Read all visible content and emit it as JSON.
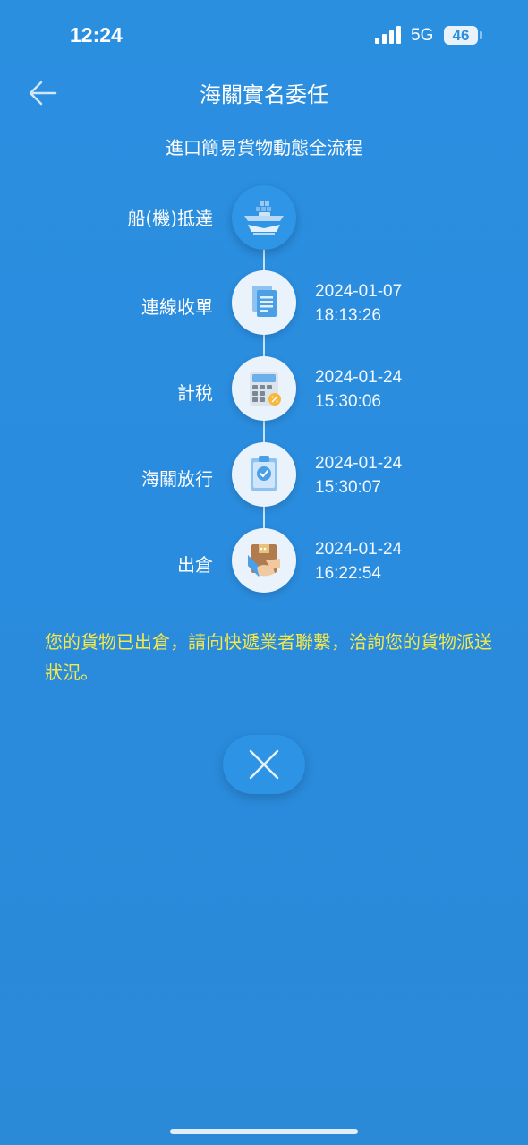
{
  "status_bar": {
    "time": "12:24",
    "network": "5G",
    "battery": "46",
    "signal_icon": "cellular-signal-icon"
  },
  "header": {
    "back_icon": "arrow-left-icon",
    "title": "海關實名委任"
  },
  "subtitle": "進口簡易貨物動態全流程",
  "timeline": [
    {
      "label": "船(機)抵達",
      "icon": "ship-plane-icon",
      "date": "",
      "time": ""
    },
    {
      "label": "連線收單",
      "icon": "document-icon",
      "date": "2024-01-07",
      "time": "18:13:26"
    },
    {
      "label": "計稅",
      "icon": "calculator-icon",
      "date": "2024-01-24",
      "time": "15:30:06"
    },
    {
      "label": "海關放行",
      "icon": "clipboard-check-icon",
      "date": "2024-01-24",
      "time": "15:30:07"
    },
    {
      "label": "出倉",
      "icon": "package-handover-icon",
      "date": "2024-01-24",
      "time": "16:22:54"
    }
  ],
  "notice": "您的貨物已出倉，請向快遞業者聯繫，洽詢您的貨物派送狀況。",
  "close_icon": "close-icon",
  "colors": {
    "background": "#2b8fe0",
    "notice_text": "#f5e84a",
    "icon_bg": "#eaf3fc"
  }
}
